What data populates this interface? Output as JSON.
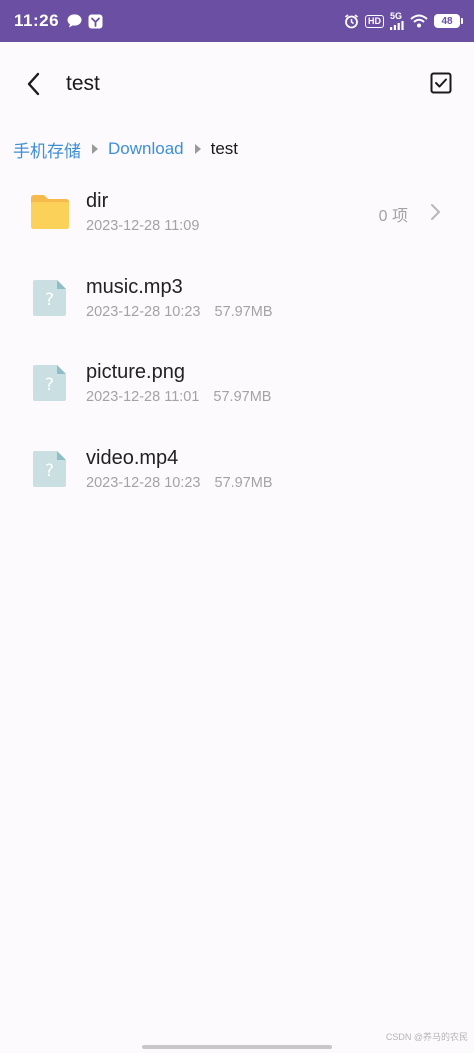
{
  "status_bar": {
    "time": "11:26",
    "network": "5G",
    "hd": "HD",
    "battery": "48",
    "left_icons": [
      "message-bubble-icon",
      "download-app-icon"
    ],
    "right_icons": [
      "alarm-icon",
      "hd-icon",
      "cellular-5g-icon",
      "wifi-icon",
      "battery-icon"
    ]
  },
  "header": {
    "title": "test",
    "back_icon": "chevron-left-icon",
    "select_icon": "checkbox-icon"
  },
  "breadcrumb": {
    "items": [
      "手机存储",
      "Download",
      "test"
    ]
  },
  "files": [
    {
      "name": "dir",
      "type": "folder",
      "date": "2023-12-28 11:09",
      "size": "",
      "count": "0 项"
    },
    {
      "name": "music.mp3",
      "type": "unknown",
      "date": "2023-12-28 10:23",
      "size": "57.97MB"
    },
    {
      "name": "picture.png",
      "type": "unknown",
      "date": "2023-12-28 11:01",
      "size": "57.97MB"
    },
    {
      "name": "video.mp4",
      "type": "unknown",
      "date": "2023-12-28 10:23",
      "size": "57.97MB"
    }
  ],
  "watermark": "CSDN @养马的农民",
  "colors": {
    "status_bar": "#6a4fa3",
    "accent_link": "#3d8fd6",
    "folder": "#fcd15a",
    "unknown_file": "#c9dfe2"
  }
}
